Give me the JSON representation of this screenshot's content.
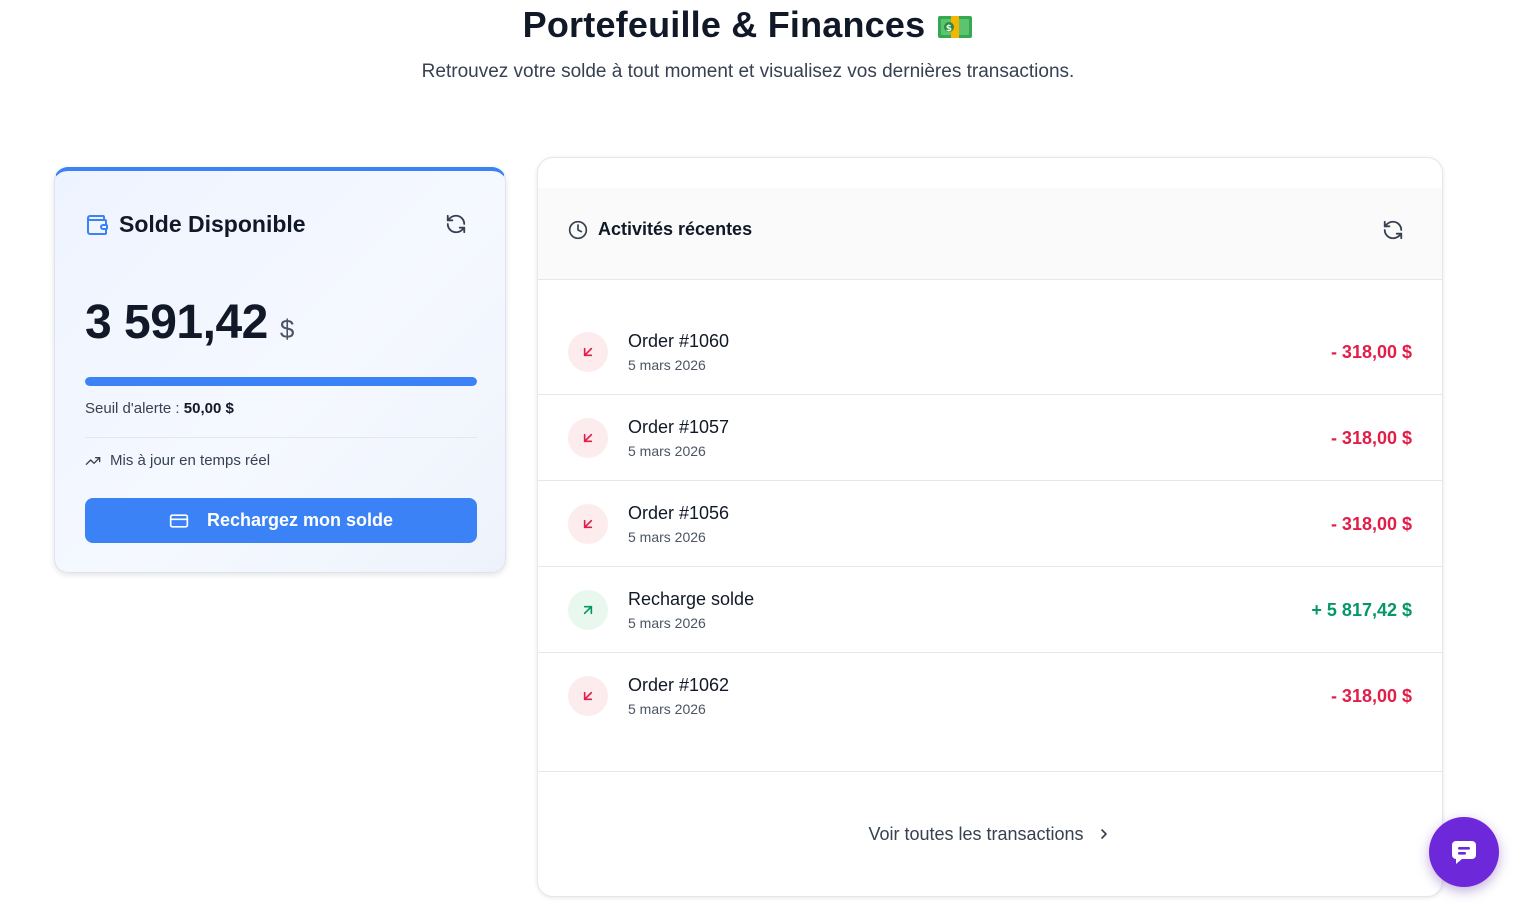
{
  "page": {
    "title": "Portefeuille & Finances",
    "subtitle": "Retrouvez votre solde à tout moment et visualisez vos dernières transactions."
  },
  "balance": {
    "title": "Solde Disponible",
    "amount": "3 591,42",
    "currency": "$",
    "threshold_label": "Seuil d'alerte : ",
    "threshold_value": "50,00 $",
    "progress_fraction": 1.0,
    "live_label": "Mis à jour en temps réel",
    "button_label": "Rechargez mon solde",
    "accent_color": "#3b82f6"
  },
  "activity": {
    "title": "Activités récentes",
    "transactions": [
      {
        "name": "Order #1060",
        "date": "5 mars 2026",
        "amount": "- 318,00 $",
        "direction": "out"
      },
      {
        "name": "Order #1057",
        "date": "5 mars 2026",
        "amount": "- 318,00 $",
        "direction": "out"
      },
      {
        "name": "Order #1056",
        "date": "5 mars 2026",
        "amount": "- 318,00 $",
        "direction": "out"
      },
      {
        "name": "Recharge solde",
        "date": "5 mars 2026",
        "amount": "+ 5 817,42 $",
        "direction": "in"
      },
      {
        "name": "Order #1062",
        "date": "5 mars 2026",
        "amount": "- 318,00 $",
        "direction": "out"
      }
    ],
    "footer_link": "Voir toutes les transactions",
    "colors": {
      "out": "#e11d48",
      "in": "#059669"
    }
  },
  "chat": {
    "icon": "chat-bubble-icon",
    "color": "#6d28d9"
  }
}
